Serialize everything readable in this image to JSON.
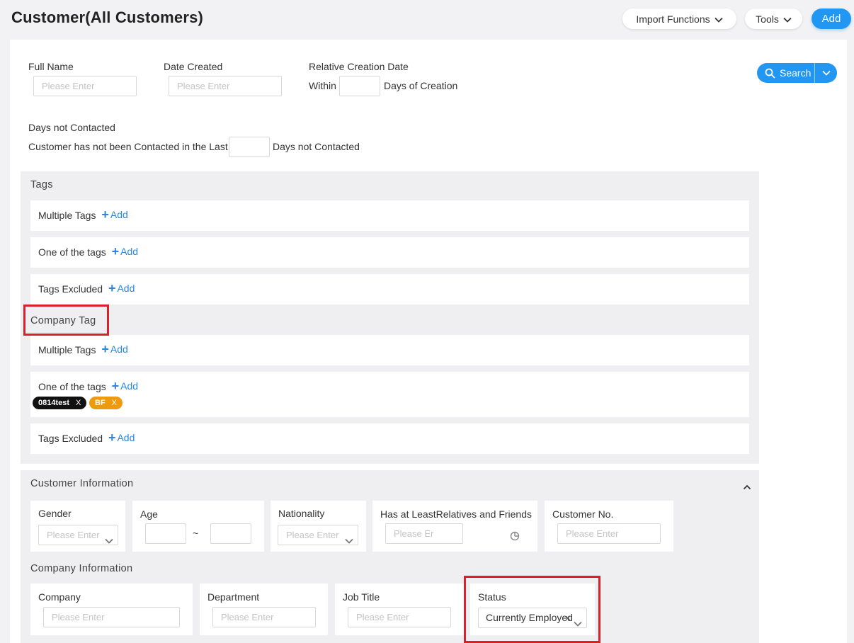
{
  "header": {
    "title": "Customer(All Customers)",
    "import_label": "Import Functions",
    "tools_label": "Tools",
    "add_label": "Add"
  },
  "filters": {
    "full_name_label": "Full Name",
    "full_name_placeholder": "Please Enter",
    "date_created_label": "Date Created",
    "date_created_placeholder": "Please Enter",
    "relative_label": "Relative Creation Date",
    "within_label": "Within",
    "days_creation_label": "Days of Creation",
    "days_not_contacted_label": "Days not Contacted",
    "not_contacted_prefix": "Customer has not been Contacted in the Last",
    "not_contacted_suffix": "Days not Contacted",
    "search_label": "Search"
  },
  "tags": {
    "title": "Tags",
    "multiple_label": "Multiple Tags",
    "one_of_label": "One of the tags",
    "excluded_label": "Tags Excluded",
    "add_label": "Add"
  },
  "company_tag": {
    "title": "Company Tag",
    "multiple_label": "Multiple Tags",
    "one_of_label": "One of the tags",
    "excluded_label": "Tags Excluded",
    "add_label": "Add",
    "chips": [
      {
        "label": "0814test",
        "remove": "X",
        "color": "#111111"
      },
      {
        "label": "BF",
        "remove": "X",
        "color": "#ee9a0f"
      }
    ]
  },
  "customer_info": {
    "title": "Customer Information",
    "gender_label": "Gender",
    "gender_placeholder": "Please Enter",
    "age_label": "Age",
    "age_separator": "~",
    "nationality_label": "Nationality",
    "nationality_placeholder": "Please Enter",
    "relatives_label": "Has at LeastRelatives and Friends",
    "relatives_placeholder": "Please Er",
    "customer_no_label": "Customer No.",
    "customer_no_placeholder": "Please Enter"
  },
  "company_info": {
    "title": "Company Information",
    "company_label": "Company",
    "company_placeholder": "Please Enter",
    "department_label": "Department",
    "department_placeholder": "Please Enter",
    "job_title_label": "Job Title",
    "job_title_placeholder": "Please Enter",
    "status_label": "Status",
    "status_value": "Currently Employed",
    "status_clear": "×"
  },
  "colors": {
    "accent": "#2197f3",
    "link": "#2a86e0",
    "highlight": "#dc2029",
    "section_bg": "#efeff1"
  }
}
